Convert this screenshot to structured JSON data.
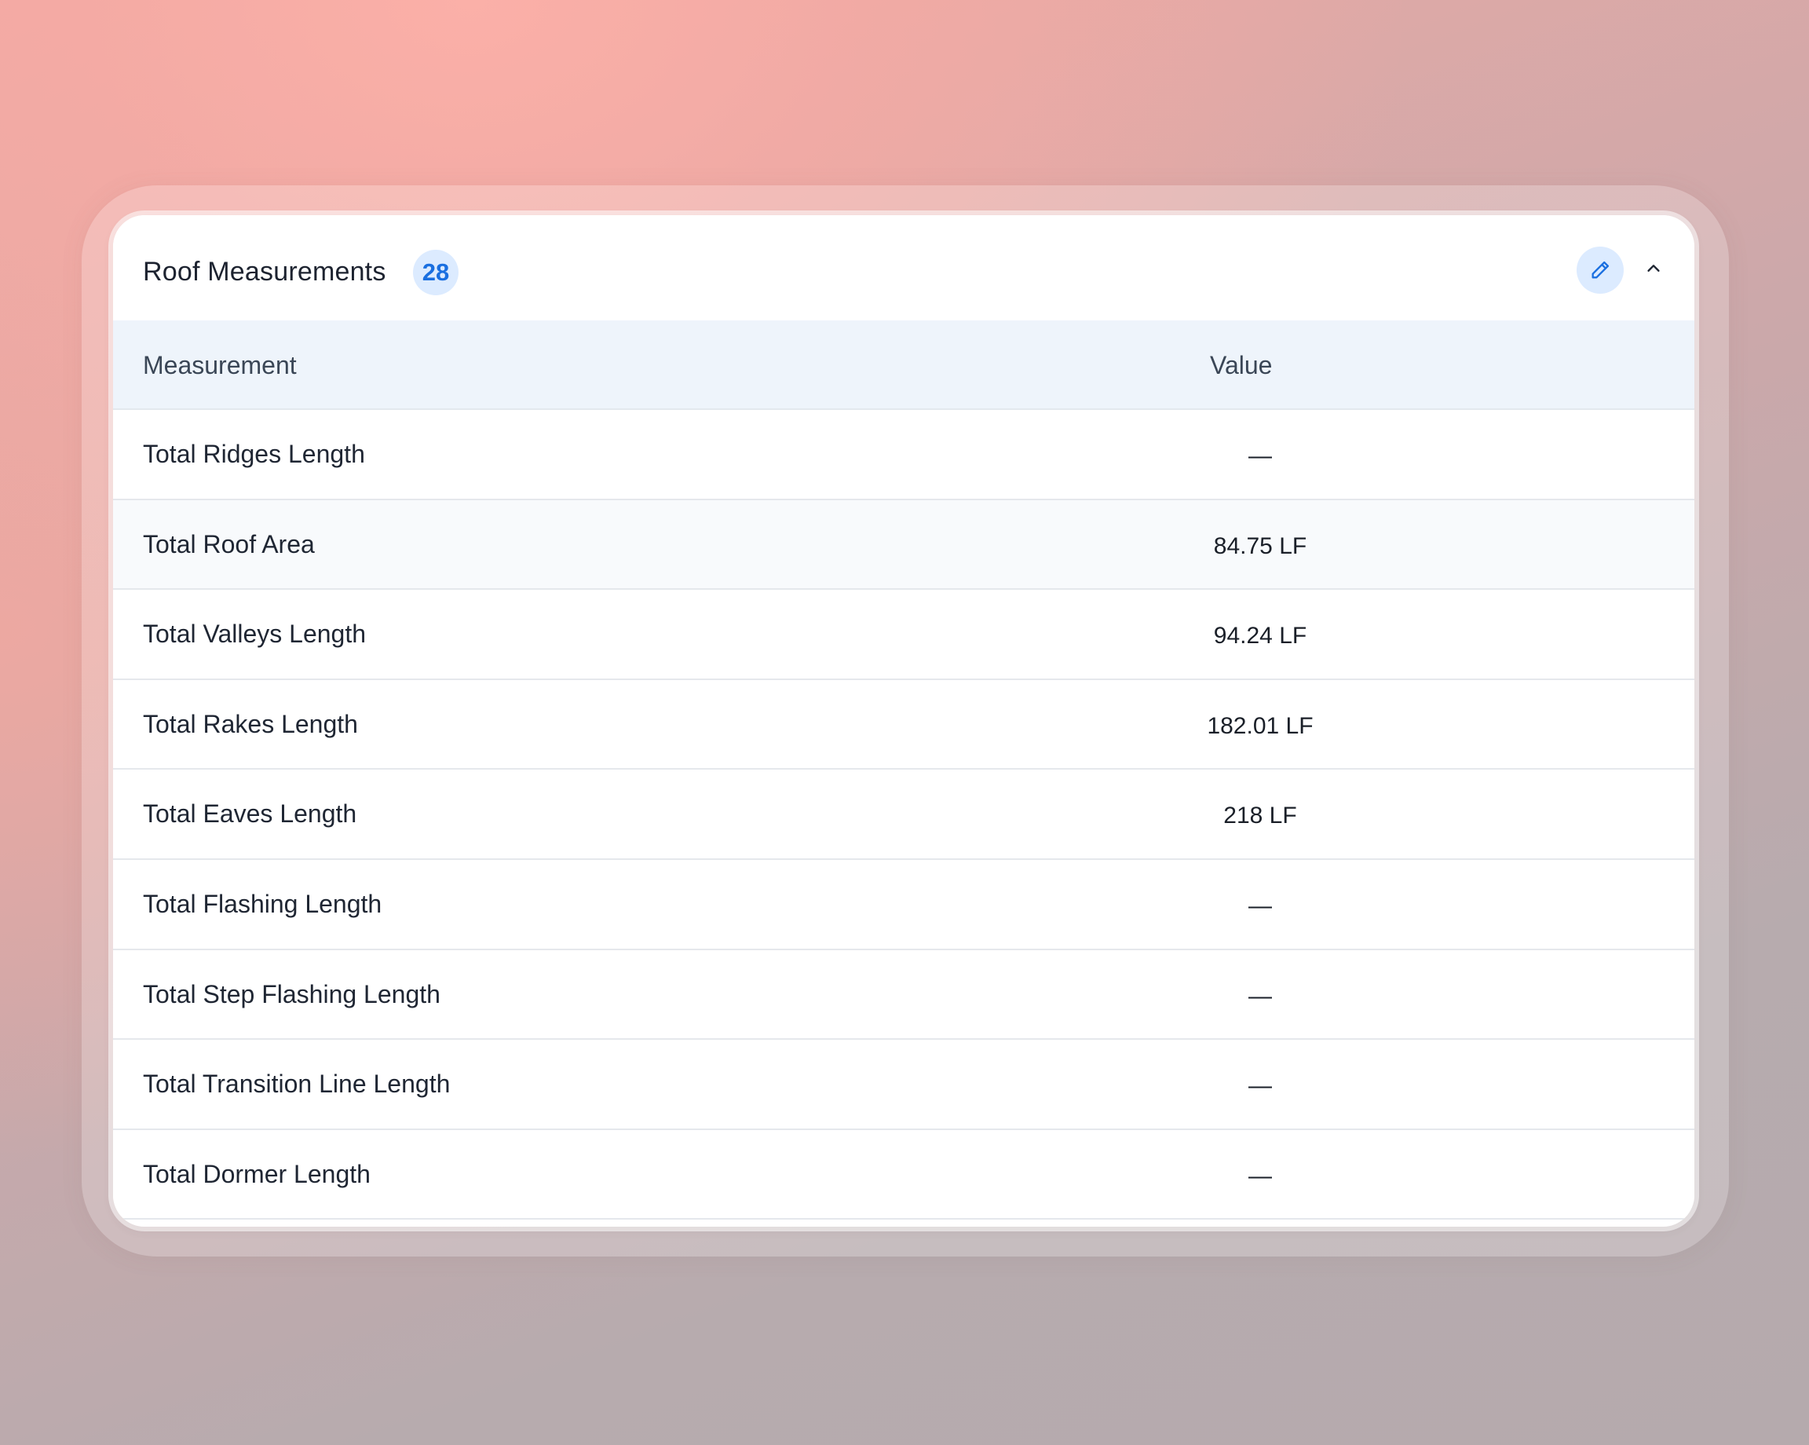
{
  "panel": {
    "title": "Roof Measurements",
    "count": "28"
  },
  "icons": {
    "edit": "pencil-icon",
    "collapse": "chevron-up-icon"
  },
  "colors": {
    "accent": "#1a6fe0",
    "badge_bg": "#dcebff",
    "header_bg": "#eef4fb"
  },
  "table": {
    "headers": {
      "measurement": "Measurement",
      "value": "Value"
    },
    "rows": [
      {
        "label": "Total Ridges Length",
        "value": "—"
      },
      {
        "label": "Total Roof Area",
        "value": "84.75 LF"
      },
      {
        "label": "Total Valleys Length",
        "value": "94.24 LF"
      },
      {
        "label": "Total Rakes Length",
        "value": "182.01 LF"
      },
      {
        "label": "Total Eaves Length",
        "value": "218 LF"
      },
      {
        "label": "Total Flashing Length",
        "value": "—"
      },
      {
        "label": "Total Step Flashing Length",
        "value": "—"
      },
      {
        "label": "Total Transition Line Length",
        "value": "—"
      },
      {
        "label": "Total Dormer Length",
        "value": "—"
      }
    ]
  }
}
